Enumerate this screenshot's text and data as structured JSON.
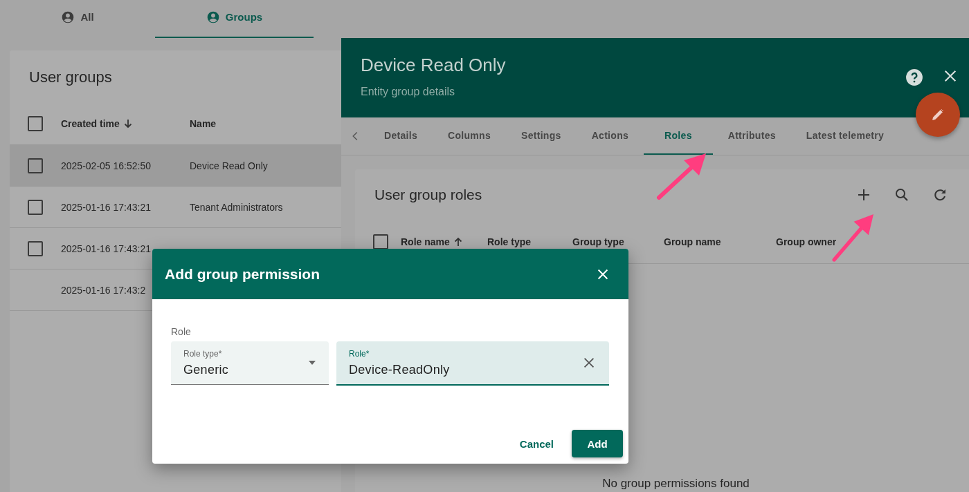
{
  "top_tabs": [
    {
      "label": "All",
      "selected": false
    },
    {
      "label": "Groups",
      "selected": true
    }
  ],
  "user_groups": {
    "title": "User groups",
    "all_checked": false,
    "columns": [
      {
        "label": "Created time",
        "sort_ascending": false
      },
      {
        "label": "Name"
      }
    ],
    "rows": [
      {
        "created_time": "2025-02-05 16:52:50",
        "name": "Device Read Only",
        "selected": true,
        "selectable": true
      },
      {
        "created_time": "2025-01-16 17:43:21",
        "name": "Tenant Administrators",
        "selected": false,
        "selectable": true
      },
      {
        "created_time": "2025-01-16 17:43:21",
        "selected": false,
        "selectable": true
      },
      {
        "created_time": "2025-01-16 17:43:2",
        "selected": false,
        "selectable": false
      }
    ]
  },
  "details_panel": {
    "title": "Device Read Only",
    "subtitle": "Entity group details",
    "tabs": [
      {
        "label": "Details",
        "selected": false
      },
      {
        "label": "Columns",
        "selected": false
      },
      {
        "label": "Settings",
        "selected": false
      },
      {
        "label": "Actions",
        "selected": false
      },
      {
        "label": "Roles",
        "selected": true
      },
      {
        "label": "Attributes",
        "selected": false
      },
      {
        "label": "Latest telemetry",
        "selected": false
      }
    ],
    "roles_card": {
      "title": "User group roles",
      "all_checked": false,
      "columns": [
        {
          "label": "Role name",
          "sort_ascending": true
        },
        {
          "label": "Role type"
        },
        {
          "label": "Group type"
        },
        {
          "label": "Group name"
        },
        {
          "label": "Group owner"
        }
      ],
      "empty_message": "No group permissions found"
    }
  },
  "dialog": {
    "title": "Add group permission",
    "section_label": "Role",
    "fields": [
      {
        "kind": "select",
        "label": "Role type*",
        "value": "Generic",
        "focused": false
      },
      {
        "kind": "autocomplete",
        "label": "Role*",
        "value": "Device-ReadOnly",
        "focused": true
      }
    ],
    "buttons": [
      {
        "kind": "text",
        "label": "Cancel"
      },
      {
        "kind": "raised",
        "label": "Add"
      }
    ]
  }
}
